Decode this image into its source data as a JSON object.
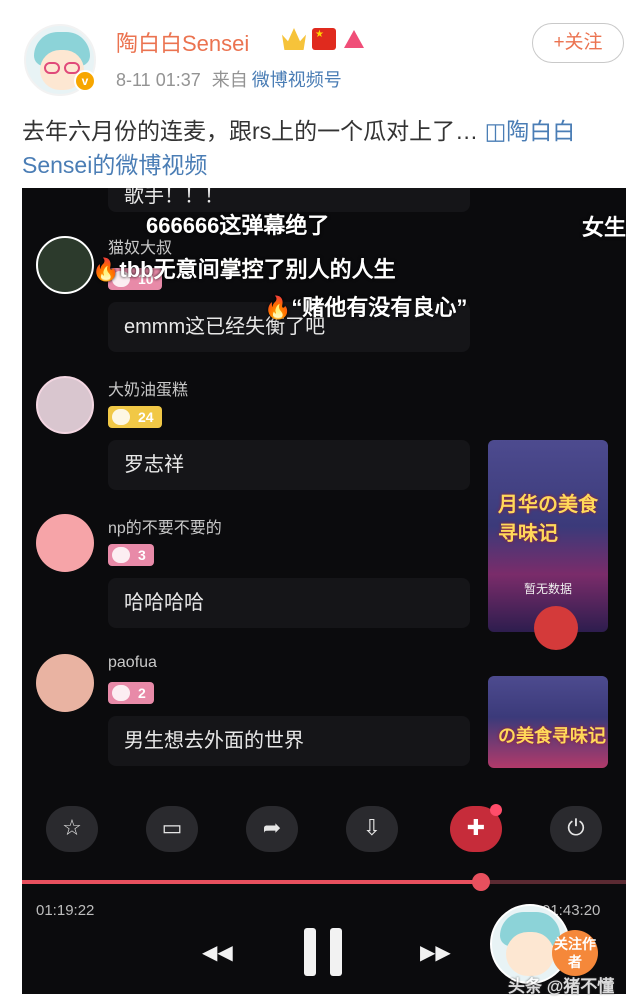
{
  "post": {
    "username": "陶白白Sensei",
    "timestamp": "8-11 01:37",
    "source_prefix": "来自",
    "source": "微博视频号",
    "follow_label": "+关注",
    "text": "去年六月份的连麦，跟rs上的一个瓜对上了…",
    "link_icon": "video-link-icon",
    "link_text": "陶白白Sensei的微博视频"
  },
  "video": {
    "top_partial_text": "歌手！！！",
    "messages": [
      {
        "name": "猫奴大叔",
        "level": "10",
        "text": "emmm这已经失衡了吧"
      },
      {
        "name": "大奶油蛋糕",
        "level": "24",
        "text": "罗志祥"
      },
      {
        "name": "np的不要不要的",
        "level": "3",
        "text": "哈哈哈哈"
      },
      {
        "name": "paofua",
        "level": "2",
        "text": "男生想去外面的世界"
      }
    ],
    "danmu": [
      "666666这弹幕绝了",
      "女生",
      "tbb无意间掌控了别人的人生",
      "“赌他有没有良心”"
    ],
    "thumbnails": [
      {
        "title": "月华の美食寻味记",
        "status": "暂无数据"
      },
      {
        "title": "の美食寻味记"
      }
    ],
    "controls": [
      "star-icon",
      "camera-icon",
      "share-icon",
      "download-icon",
      "gift-icon",
      "power-icon"
    ],
    "elapsed": "01:19:22",
    "duration": "01:43:20",
    "progress": 0.76,
    "follow_author_label": "关注作者",
    "watermark": "头条 @猪不懂"
  },
  "colors": {
    "accent": "#eb7350",
    "link": "#4a7db5",
    "progress": "#e8505e"
  }
}
